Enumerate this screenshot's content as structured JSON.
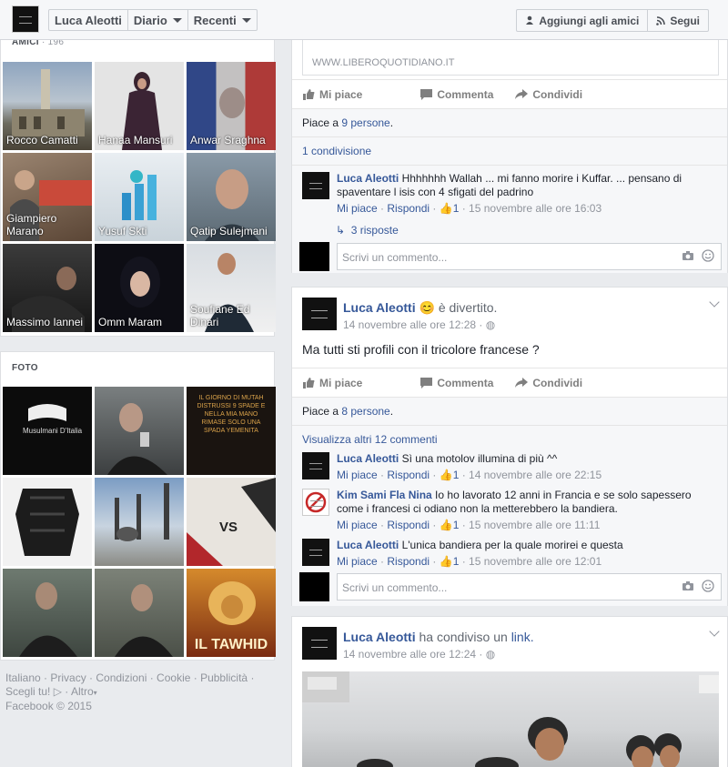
{
  "topbar": {
    "name": "Luca Aleotti",
    "diary": "Diario",
    "recent": "Recenti",
    "add_friend": "Aggiungi agli amici",
    "follow": "Segui"
  },
  "friends": {
    "title": "AMICI",
    "count": "· 196",
    "items": [
      "Rocco Camatti",
      "Hanaa Mansuri",
      "Anwar Sraghna",
      "Giampiero Marano",
      "Yusuf Skti",
      "Qatip Sulejmani",
      "Massimo Iannei",
      "Omm Maram",
      "Soufiane Ed Dinari"
    ]
  },
  "photos": {
    "title": "FOTO",
    "t1": "Musulmani D'Italia",
    "t2": "IL GIORNO DI MUTAH DISTRUSSI 9 SPADE E NELLA MIA MANO RIMASE SOLO UNA SPADA YEMENITA",
    "t3": "VS",
    "t4": "IL TAWHID"
  },
  "footer": {
    "links": "Italiano · Privacy · Condizioni · Cookie · Pubblicità ·",
    "choices": "Scegli tu!",
    "more": "· Altro",
    "copyright": "Facebook © 2015"
  },
  "post1": {
    "link_domain": "WWW.LIBEROQUOTIDIANO.IT",
    "like": "Mi piace",
    "comment": "Commenta",
    "share": "Condividi",
    "likes_prefix": "Piace a ",
    "likes_link": "9 persone",
    "shares": "1 condivisione",
    "comment1": {
      "name": "Luca Aleotti",
      "text": "Hhhhhhh Wallah ... mi fanno morire i Kuffar. ... pensano di spaventare l isis con 4 sfigati del padrino",
      "like": "Mi piace",
      "reply": "Rispondi",
      "likes": "1",
      "time": "· 15 novembre alle ore 16:03"
    },
    "replies": "3 risposte",
    "write_placeholder": "Scrivi un commento..."
  },
  "post2": {
    "name": "Luca Aleotti",
    "feeling": "è divertito.",
    "time": "14 novembre alle ore 12:28 ·",
    "text": "Ma tutti sti profili con il tricolore francese ?",
    "like": "Mi piace",
    "comment": "Commenta",
    "share": "Condividi",
    "likes_prefix": "Piace a ",
    "likes_link": "8 persone",
    "more_comments": "Visualizza altri 12 commenti",
    "comments": [
      {
        "name": "Luca Aleotti",
        "text": "Sì una motolov illumina di più ^^",
        "time": "· 14 novembre alle ore 22:15",
        "likes": "1"
      },
      {
        "name": "Kim Sami Fla Nina",
        "text": "Io ho lavorato 12 anni in Francia e se solo sapessero come i francesi ci odiano non la metterebbero la bandiera.",
        "time": "· 15 novembre alle ore 11:11",
        "likes": "1"
      },
      {
        "name": "Luca Aleotti",
        "text": "L'unica bandiera per la quale morirei e questa",
        "time": "· 15 novembre alle ore 12:01",
        "likes": "1"
      }
    ],
    "like_label": "Mi piace",
    "reply_label": "Rispondi",
    "write_placeholder": "Scrivi un commento..."
  },
  "post3": {
    "name": "Luca Aleotti",
    "action": "ha condiviso un",
    "link": "link.",
    "time": "14 novembre alle ore 12:24 ·"
  }
}
